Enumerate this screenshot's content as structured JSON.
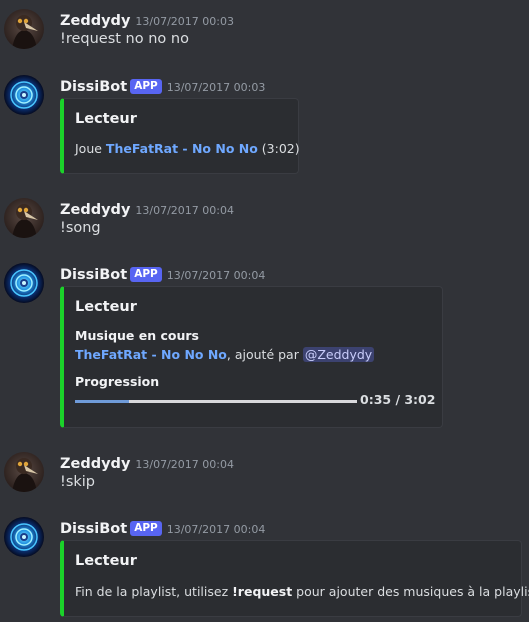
{
  "messages": [
    {
      "author": "Zeddydy",
      "avatar_icon": "plague-doctor-avatar",
      "timestamp": "13/07/2017 00:03",
      "text": "!request no no no"
    },
    {
      "author": "DissiBot",
      "app_tag": "APP",
      "avatar_icon": "cyber-eye-avatar",
      "timestamp": "13/07/2017 00:03",
      "embed": {
        "title": "Lecteur",
        "prefix": "Joue ",
        "track": "TheFatRat - No No No",
        "duration": " (3:02)"
      }
    },
    {
      "author": "Zeddydy",
      "avatar_icon": "plague-doctor-avatar",
      "timestamp": "13/07/2017 00:04",
      "text": "!song"
    },
    {
      "author": "DissiBot",
      "app_tag": "APP",
      "avatar_icon": "cyber-eye-avatar",
      "timestamp": "13/07/2017 00:04",
      "embed": {
        "title": "Lecteur",
        "field1_name": "Musique en cours",
        "track": "TheFatRat - No No No",
        "added_by_text": ", ajouté par ",
        "mention": "@Zeddydy",
        "field2_name": "Progression",
        "progress_fraction": 0.19,
        "progress_time": "0:35 / 3:02"
      }
    },
    {
      "author": "Zeddydy",
      "avatar_icon": "plague-doctor-avatar",
      "timestamp": "13/07/2017 00:04",
      "text": "!skip"
    },
    {
      "author": "DissiBot",
      "app_tag": "APP",
      "avatar_icon": "cyber-eye-avatar",
      "timestamp": "13/07/2017 00:04",
      "embed": {
        "title": "Lecteur",
        "text_before": "Fin de la playlist, utilisez ",
        "command": "!request",
        "text_after": " pour ajouter des musiques à la playlist"
      }
    }
  ],
  "colors": {
    "background": "#313338",
    "embed_background": "#2b2d31",
    "embed_accent": "#1bd22a",
    "link": "#6fa8ff",
    "app_tag": "#5865f2"
  }
}
